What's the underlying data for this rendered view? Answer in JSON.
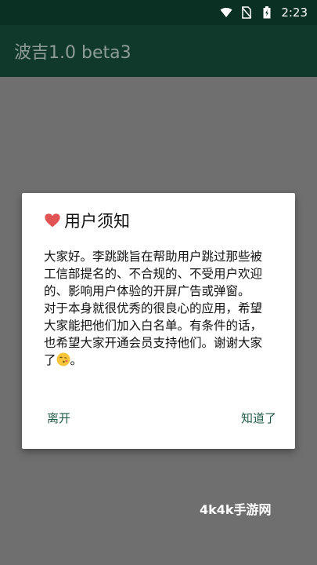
{
  "status_bar": {
    "time": "2:23",
    "icons": [
      "wifi-icon",
      "no-sim-icon",
      "battery-charging-icon"
    ]
  },
  "app_bar": {
    "title": "波吉1.0 beta3"
  },
  "dialog": {
    "title_icon": "heart-icon",
    "title": "用户须知",
    "paragraph1": "大家好。李跳跳旨在帮助用户跳过那些被工信部提名的、不合规的、不受用户欢迎的、影响用户体验的开屏广告或弹窗。",
    "paragraph2": "对于本身就很优秀的很良心的应用，希望大家能把他们加入白名单。有条件的话，也希望大家开通会员支持他们。谢谢大家了",
    "paragraph2_end": "。",
    "emoji": "blowing-kiss-emoji-icon",
    "leave_label": "离开",
    "ok_label": "知道了"
  },
  "watermark": "4k4k手游网",
  "colors": {
    "status_bar_bg": "#0a2f23",
    "app_bar_bg": "#10392c",
    "overlay_bg": "#6f6f6f",
    "accent": "#1d5a45",
    "heart": "#e05454"
  }
}
